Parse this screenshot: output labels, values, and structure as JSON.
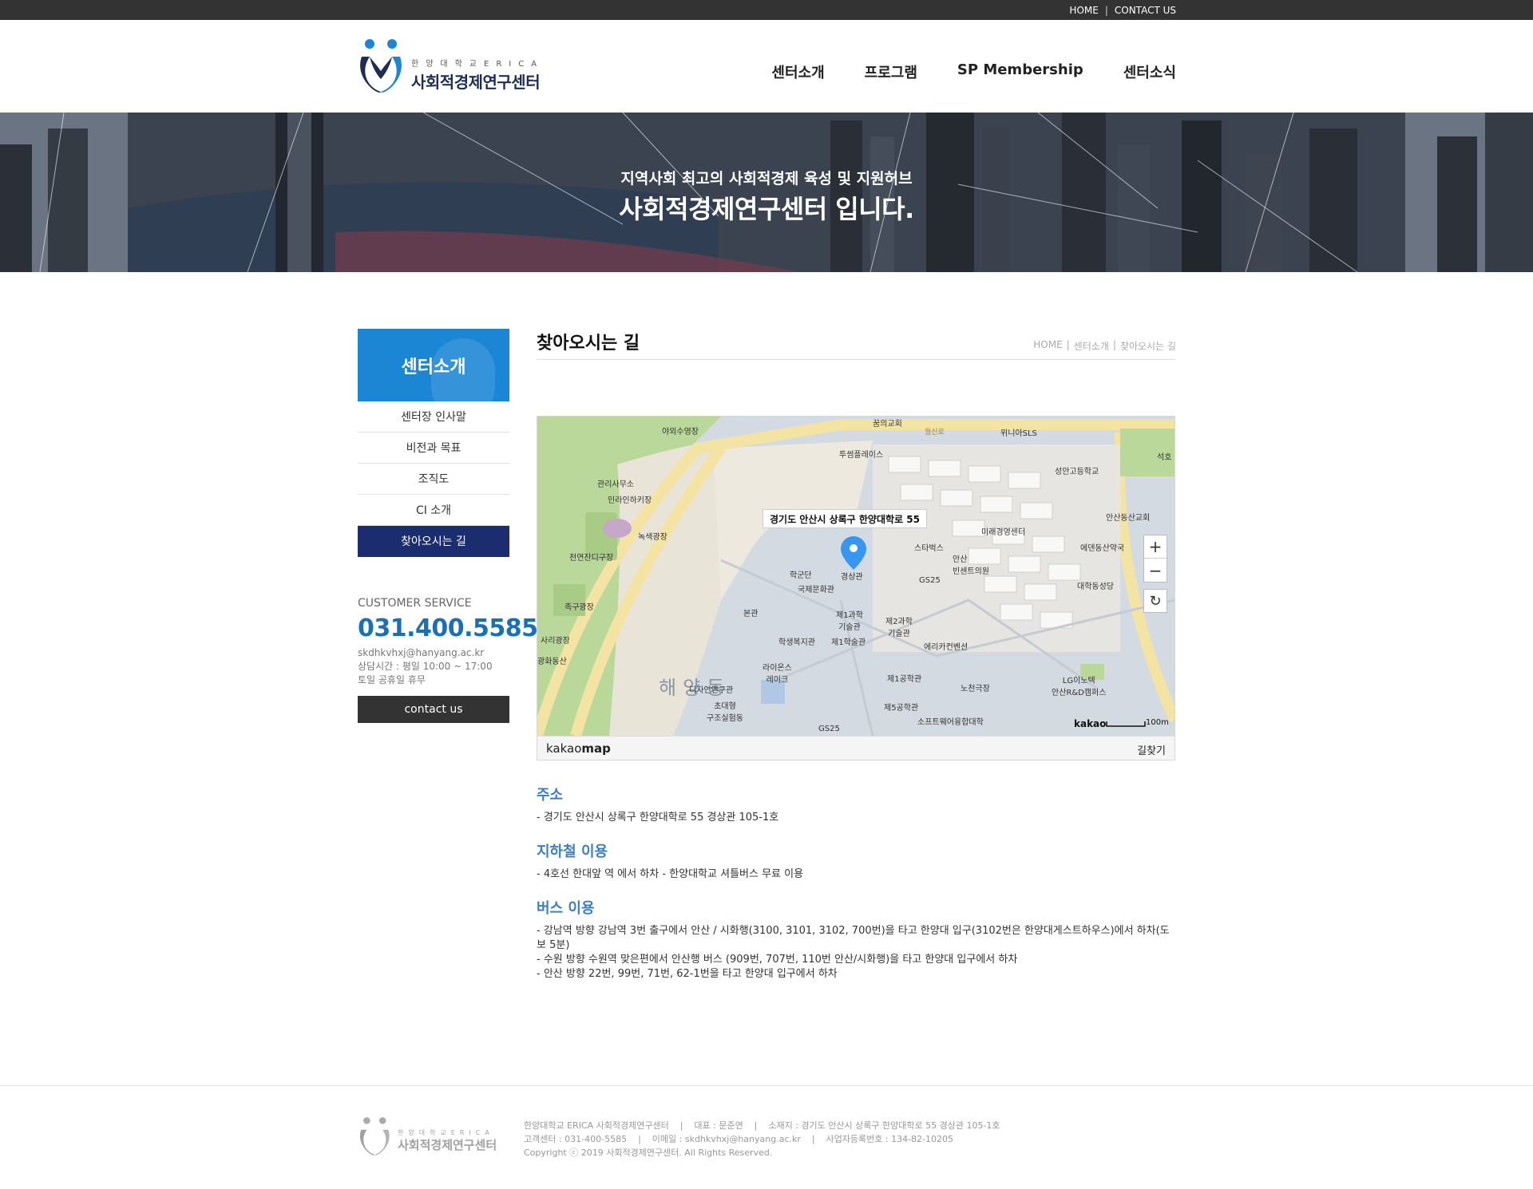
{
  "topbar": {
    "home": "HOME",
    "separator": "|",
    "contact": "CONTACT US"
  },
  "logo": {
    "small": "한양대학교ERICA",
    "name": "사회적경제연구센터"
  },
  "gnb": [
    "센터소개",
    "프로그램",
    "SP Membership",
    "센터소식"
  ],
  "hero": {
    "subtitle": "지역사회 최고의 사회적경제 육성 및 지원허브",
    "title": "사회적경제연구센터 입니다."
  },
  "sidebar": {
    "title": "센터소개",
    "items": [
      {
        "label": "센터장 인사말",
        "active": false
      },
      {
        "label": "비전과 목표",
        "active": false
      },
      {
        "label": "조직도",
        "active": false
      },
      {
        "label": "CI 소개",
        "active": false
      },
      {
        "label": "찾아오시는 길",
        "active": true
      }
    ]
  },
  "customer_service": {
    "label": "CUSTOMER SERVICE",
    "phone": "031.400.5585",
    "email": "skdhkvhxj@hanyang.ac.kr",
    "hours": "상담시간 : 평일 10:00 ~ 17:00",
    "holiday": "토일 공휴일 휴무",
    "button": "contact us"
  },
  "page": {
    "title": "찾아오시는 길",
    "breadcrumb": [
      "HOME",
      "|",
      "센터소개",
      "|",
      "찾아오시는 길"
    ]
  },
  "map": {
    "tooltip": "경기도 안산시 상록구 한양대학로 55",
    "zoom_in": "+",
    "zoom_out": "−",
    "refresh": "↻",
    "brand_prefix": "kakao",
    "brand_suffix": "map",
    "route": "길찾기",
    "logo": "kakao",
    "scale": "100m",
    "labels": {
      "l1": "꿈의교회",
      "l2": "야외수영장",
      "l3": "월신로",
      "l4": "위니아SLS",
      "l5": "투썸플레이스",
      "l6": "성안고등학교",
      "l7": "석호",
      "l8": "관리사무소",
      "l9": "인라인하키장",
      "l10": "녹색광장",
      "l11": "안산동산교회",
      "l12": "미래경영센터",
      "l13": "스타벅스",
      "l14": "에덴동산약국",
      "l15": "천연잔디구장",
      "l16": "안산\n빈센트의원",
      "l17": "학군단",
      "l18": "경상관",
      "l19": "GS25",
      "l20": "국제문화관",
      "l21": "대학동성당",
      "l22": "족구광장",
      "l23": "본관",
      "l24": "제1과학\n기술관",
      "l25": "제2과학\n기술관",
      "l26": "사리광장",
      "l27": "학생복지관",
      "l28": "제1학술관",
      "l29": "에리카컨벤션",
      "l30": "광화동산",
      "l31": "해양동",
      "l32": "라이온스\n레이크",
      "l33": "제1공학관",
      "l34": "LG이노텍\n안산R&D캠퍼스",
      "l35": "디자인연구관",
      "l36": "노천극장",
      "l37": "초대형\n구조실험동",
      "l38": "제5공학관",
      "l39": "소프트웨어융합대학",
      "l40": "GS25"
    }
  },
  "sections": [
    {
      "heading": "주소",
      "lines": [
        "-  경기도 안산시 상록구 한양대학로 55 경상관 105-1호"
      ]
    },
    {
      "heading": "지하철 이용",
      "lines": [
        "-  4호선 한대앞 역 에서 하차 - 한양대학교 셔틀버스 무료 이용"
      ]
    },
    {
      "heading": "버스 이용",
      "lines": [
        "-  강남역 방향 강남역 3번 출구에서 안산 / 시화행(3100, 3101, 3102, 700번)을 타고 한양대 입구(3102번은 한양대게스트하우스)에서 하차(도보 5분)",
        "-  수원 방향 수원역 맞은편에서 안산행 버스 (909번, 707번, 110번 안산/시화행)을 타고 한양대 입구에서 하차",
        "-  안산 방향 22번, 99번, 71번, 62-1번을 타고 한양대 입구에서 하차"
      ]
    }
  ],
  "footer": {
    "logo_small": "한양대학교ERICA",
    "logo_name": "사회적경제연구센터",
    "line1": "한양대학교 ERICA 사회적경제연구센터    |    대표 : 문준연    |    소재지 : 경기도 안산시 상록구 한양대학로 55 경상관 105-1호",
    "line2": "고객센터 : 031-400-5585    |    이메일 : skdhkvhxj@hanyang.ac.kr    |    사업자등록번호 : 134-82-10205",
    "line3": "Copyright ⓒ 2019 사회적경제연구센터. All Rights Reserved."
  },
  "colors": {
    "primary_blue": "#1a86d4",
    "navy": "#1b2d6e",
    "heading_blue": "#3c7ec5",
    "phone_blue": "#1b6fb5"
  }
}
